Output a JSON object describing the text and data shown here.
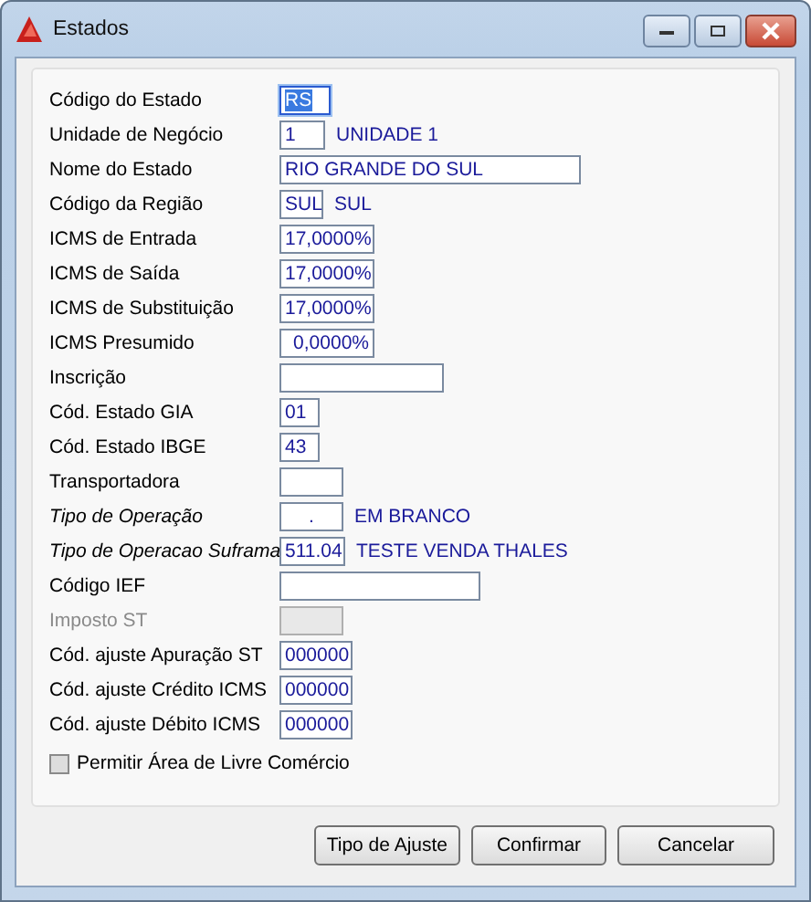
{
  "window": {
    "title": "Estados"
  },
  "fields": [
    {
      "label": "Código do Estado",
      "value": "RS",
      "selected": true,
      "disabled": false,
      "italic": false,
      "kind": "text"
    },
    {
      "label": "Unidade de Negócio",
      "value": "1",
      "description": "UNIDADE 1",
      "selected": false,
      "disabled": false,
      "italic": false,
      "kind": "text"
    },
    {
      "label": "Nome do Estado",
      "value": "RIO GRANDE DO SUL",
      "selected": false,
      "disabled": false,
      "italic": false,
      "kind": "text"
    },
    {
      "label": "Código da Região",
      "value": "SUL",
      "description": "SUL",
      "selected": false,
      "disabled": false,
      "italic": false,
      "kind": "text"
    },
    {
      "label": "ICMS de Entrada",
      "value": "17,0000%",
      "selected": false,
      "disabled": false,
      "italic": false,
      "kind": "percent"
    },
    {
      "label": "ICMS de Saída",
      "value": "17,0000%",
      "selected": false,
      "disabled": false,
      "italic": false,
      "kind": "percent"
    },
    {
      "label": "ICMS de Substituição",
      "value": "17,0000%",
      "selected": false,
      "disabled": false,
      "italic": false,
      "kind": "percent"
    },
    {
      "label": "ICMS Presumido",
      "value": "0,0000%",
      "selected": false,
      "disabled": false,
      "italic": false,
      "kind": "percent"
    },
    {
      "label": "Inscrição",
      "selected": false,
      "disabled": false,
      "italic": false,
      "kind": "text"
    },
    {
      "label": "Cód. Estado GIA",
      "value": "01",
      "selected": false,
      "disabled": false,
      "italic": false,
      "kind": "text"
    },
    {
      "label": "Cód. Estado IBGE",
      "value": "43",
      "selected": false,
      "disabled": false,
      "italic": false,
      "kind": "text"
    },
    {
      "label": "Transportadora",
      "selected": false,
      "disabled": false,
      "italic": false,
      "kind": "text"
    },
    {
      "label": "Tipo de Operação",
      "value": ".",
      "description": "EM BRANCO",
      "selected": false,
      "disabled": false,
      "italic": true,
      "kind": "center"
    },
    {
      "label": "Tipo de Operacao Suframa",
      "value": "511.04",
      "description": "TESTE VENDA THALES",
      "selected": false,
      "disabled": false,
      "italic": true,
      "kind": "text"
    },
    {
      "label": "Código IEF",
      "selected": false,
      "disabled": false,
      "italic": false,
      "kind": "text"
    },
    {
      "label": "Imposto ST",
      "selected": false,
      "disabled": true,
      "italic": false,
      "kind": "text"
    },
    {
      "label": "Cód. ajuste Apuração ST",
      "value": "000000",
      "selected": false,
      "disabled": false,
      "italic": false,
      "kind": "text"
    },
    {
      "label": "Cód. ajuste Crédito ICMS",
      "value": "000000",
      "selected": false,
      "disabled": false,
      "italic": false,
      "kind": "text"
    },
    {
      "label": "Cód. ajuste Débito ICMS",
      "value": "000000",
      "selected": false,
      "disabled": false,
      "italic": false,
      "kind": "text"
    }
  ],
  "checkbox": {
    "label": "Permitir Área de Livre Comércio",
    "checked": false
  },
  "buttons": [
    {
      "label": "Tipo de Ajuste"
    },
    {
      "label": "Confirmar"
    },
    {
      "label": "Cancelar"
    }
  ]
}
